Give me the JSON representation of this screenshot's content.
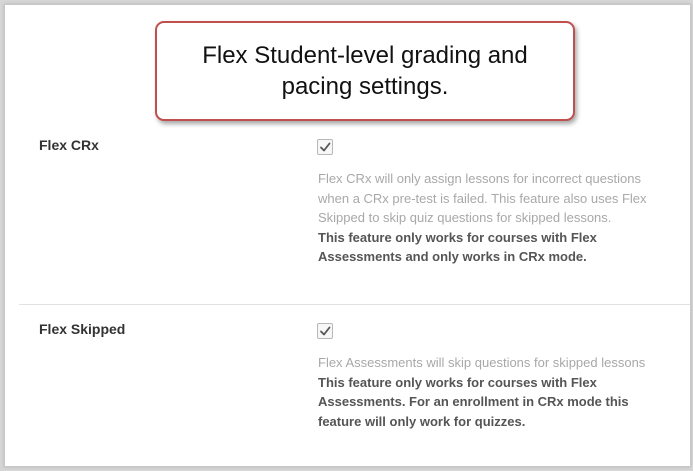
{
  "callout": {
    "text": "Flex Student-level grading and pacing settings."
  },
  "settings": [
    {
      "label": "Flex CRx",
      "checked": true,
      "description": "Flex CRx will only assign lessons for incorrect questions when a CRx pre-test is failed. This feature also uses Flex Skipped to skip quiz questions for skipped lessons.",
      "note": "This feature only works for courses with Flex Assessments and only works in CRx mode."
    },
    {
      "label": "Flex Skipped",
      "checked": true,
      "description": "Flex Assessments will skip questions for skipped lessons",
      "note": "This feature only works for courses with Flex Assessments. For an enrollment in CRx mode this feature will only work for quizzes."
    }
  ],
  "colors": {
    "callout_border": "#c0504d",
    "description_text": "#a8a8a8",
    "note_text": "#555555"
  },
  "icons": {
    "checkbox": "check-icon"
  }
}
